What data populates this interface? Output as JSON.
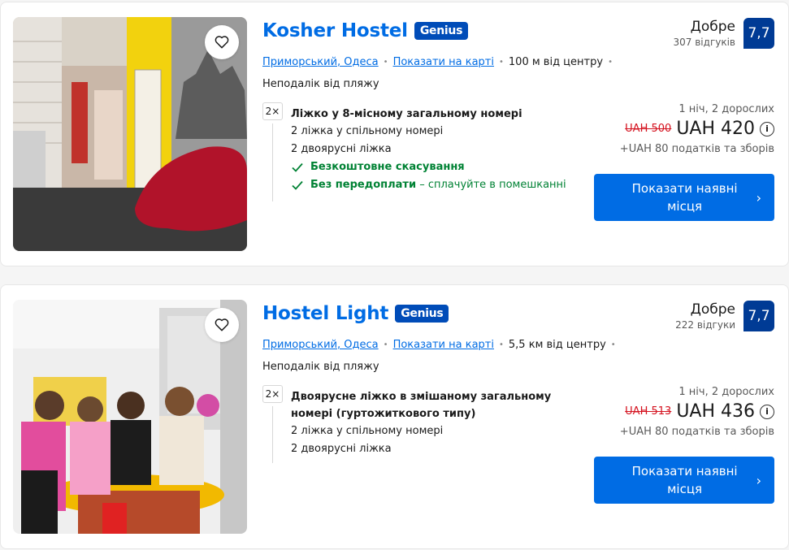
{
  "listings": [
    {
      "name": "Kosher Hostel",
      "genius": "Genius",
      "district": "Приморський, Одеса",
      "map_link": "Показати на карті",
      "distance": "100 м від центру",
      "beach": "Неподалік від пляжу",
      "room_qty": "2×",
      "room_title": "Ліжко у 8-місному загальному номері",
      "room_lines": [
        "2 ліжка у спільному номері",
        "2 двоярусні ліжка"
      ],
      "perk1": "Безкоштовне скасування",
      "perk2": "Без передоплати",
      "perk2_suffix": " – сплачуйте в помешканні",
      "review_word": "Добре",
      "review_count": "307 відгуків",
      "score": "7,7",
      "nights": "1 ніч, 2 дорослих",
      "old_price": "UAH 500",
      "new_price": "UAH 420",
      "taxes": "+UAH 80 податків та зборів",
      "button": "Показати наявні місця"
    },
    {
      "name": "Hostel Light",
      "genius": "Genius",
      "district": "Приморський, Одеса",
      "map_link": "Показати на карті",
      "distance": "5,5 км від центру",
      "beach": "Неподалік від пляжу",
      "room_qty": "2×",
      "room_title": "Двоярусне ліжко в змішаному загальному номері (гуртожиткового типу)",
      "room_lines": [
        "2 ліжка у спільному номері",
        "2 двоярусні ліжка"
      ],
      "review_word": "Добре",
      "review_count": "222 відгуки",
      "score": "7,7",
      "nights": "1 ніч, 2 дорослих",
      "old_price": "UAH 513",
      "new_price": "UAH 436",
      "taxes": "+UAH 80 податків та зборів",
      "button": "Показати наявні місця"
    }
  ],
  "icons": {
    "heart": "heart-icon",
    "check": "check-icon",
    "info": "info-icon",
    "chevron": "chevron-right-icon"
  },
  "colors": {
    "link": "#006ce4",
    "genius_bg": "#004cb8",
    "score_bg": "#003b95",
    "perk_green": "#008234",
    "old_price": "#d4111e",
    "button": "#006ce4"
  }
}
